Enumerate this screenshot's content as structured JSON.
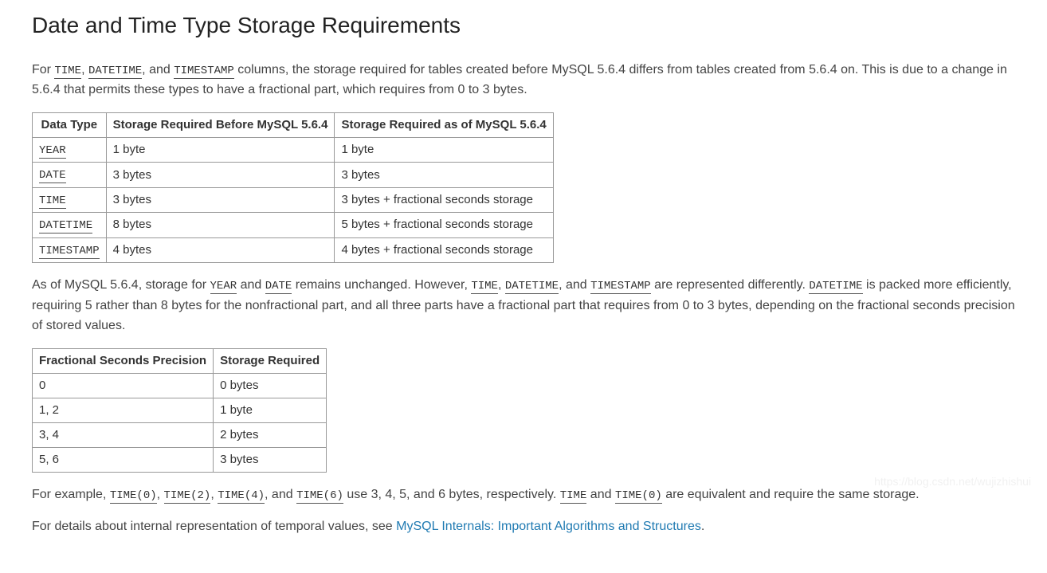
{
  "title": "Date and Time Type Storage Requirements",
  "para1": {
    "t1": "For ",
    "c1": "TIME",
    "t2": ", ",
    "c2": "DATETIME",
    "t3": ", and ",
    "c3": "TIMESTAMP",
    "t4": " columns, the storage required for tables created before MySQL 5.6.4 differs from tables created from 5.6.4 on. This is due to a change in 5.6.4 that permits these types to have a fractional part, which requires from 0 to 3 bytes."
  },
  "table1": {
    "headers": [
      "Data Type",
      "Storage Required Before MySQL 5.6.4",
      "Storage Required as of MySQL 5.6.4"
    ],
    "rows": [
      {
        "c": "YEAR",
        "b": "1 byte",
        "a": "1 byte"
      },
      {
        "c": "DATE",
        "b": "3 bytes",
        "a": "3 bytes"
      },
      {
        "c": "TIME",
        "b": "3 bytes",
        "a": "3 bytes + fractional seconds storage"
      },
      {
        "c": "DATETIME",
        "b": "8 bytes",
        "a": "5 bytes + fractional seconds storage"
      },
      {
        "c": "TIMESTAMP",
        "b": "4 bytes",
        "a": "4 bytes + fractional seconds storage"
      }
    ]
  },
  "para2": {
    "t1": "As of MySQL 5.6.4, storage for ",
    "c1": "YEAR",
    "t2": " and ",
    "c2": "DATE",
    "t3": " remains unchanged. However, ",
    "c3": "TIME",
    "t4": ", ",
    "c4": "DATETIME",
    "t5": ", and ",
    "c5": "TIMESTAMP",
    "t6": " are represented differently. ",
    "c6": "DATETIME",
    "t7": " is packed more efficiently, requiring 5 rather than 8 bytes for the nonfractional part, and all three parts have a fractional part that requires from 0 to 3 bytes, depending on the fractional seconds precision of stored values."
  },
  "table2": {
    "headers": [
      "Fractional Seconds Precision",
      "Storage Required"
    ],
    "rows": [
      {
        "p": "0",
        "s": "0 bytes"
      },
      {
        "p": "1, 2",
        "s": "1 byte"
      },
      {
        "p": "3, 4",
        "s": "2 bytes"
      },
      {
        "p": "5, 6",
        "s": "3 bytes"
      }
    ]
  },
  "para3": {
    "t1": "For example, ",
    "c1": "TIME(0)",
    "t2": ", ",
    "c2": "TIME(2)",
    "t3": ", ",
    "c3": "TIME(4)",
    "t4": ", and ",
    "c4": "TIME(6)",
    "t5": " use 3, 4, 5, and 6 bytes, respectively. ",
    "c5": "TIME",
    "t6": " and ",
    "c6": "TIME(0)",
    "t7": " are equivalent and require the same storage."
  },
  "para4": {
    "t1": "For details about internal representation of temporal values, see ",
    "link": "MySQL Internals: Important Algorithms and Structures",
    "t2": "."
  },
  "watermark": "https://blog.csdn.net/wujizhishui"
}
